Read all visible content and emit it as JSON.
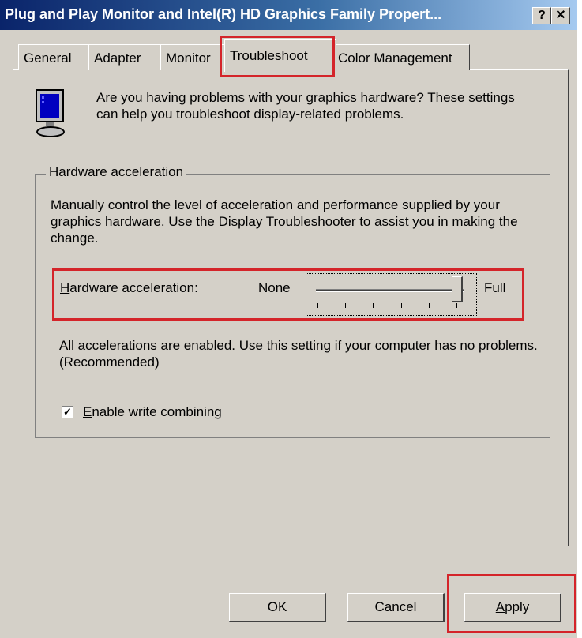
{
  "window": {
    "title": "Plug and Play Monitor and Intel(R) HD Graphics Family Propert...",
    "help_label": "?",
    "close_label": "✕"
  },
  "tabs": [
    {
      "label": "General"
    },
    {
      "label": "Adapter"
    },
    {
      "label": "Monitor"
    },
    {
      "label": "Troubleshoot",
      "active": true
    },
    {
      "label": "Color Management"
    }
  ],
  "intro_text": "Are you having problems with your graphics hardware? These settings can help you troubleshoot display-related problems.",
  "hardware_acceleration": {
    "group_title": "Hardware acceleration",
    "description": "Manually control the level of acceleration and performance supplied by your graphics hardware. Use the Display Troubleshooter to assist you in making the change.",
    "slider_label_rest": "ardware acceleration:",
    "slider_label_mnemonic": "H",
    "min_label": "None",
    "max_label": "Full",
    "level_fraction": 1.0,
    "tick_count": 6,
    "status_text": "All accelerations are enabled. Use this setting if your computer has no problems. (Recommended)"
  },
  "write_combining": {
    "mnemonic": "E",
    "label_rest": "nable write combining",
    "checked": true,
    "check_glyph": "✓"
  },
  "buttons": {
    "ok": "OK",
    "cancel": "Cancel",
    "apply_mnemonic": "A",
    "apply_rest": "pply"
  },
  "colors": {
    "highlight": "#d4242a",
    "dialog_face": "#d4d0c8",
    "titlebar_start": "#0a246a",
    "titlebar_end": "#a6caf0"
  }
}
